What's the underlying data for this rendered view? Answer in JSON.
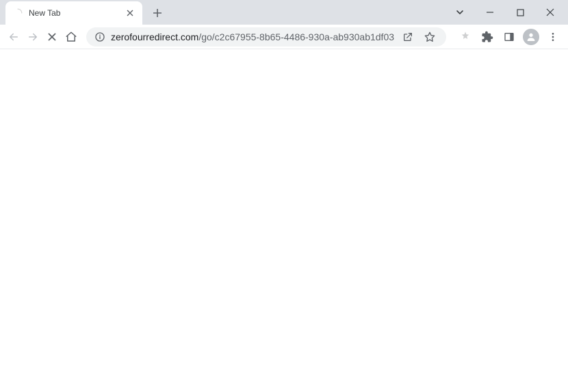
{
  "tab": {
    "title": "New Tab"
  },
  "addressbar": {
    "domain": "zerofourredirect.com",
    "path": "/go/c2c67955-8b65-4486-930a-ab930ab1df03"
  }
}
